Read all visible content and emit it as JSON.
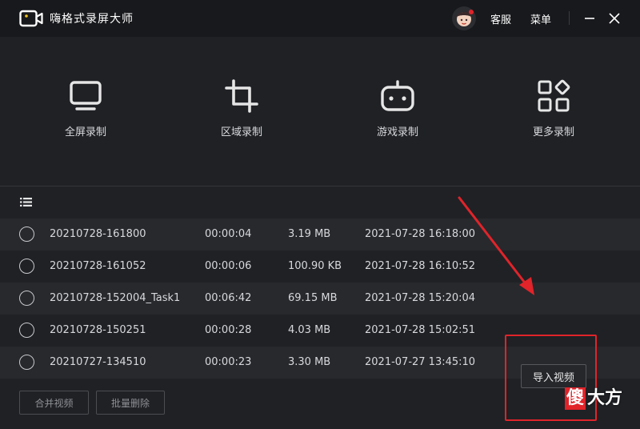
{
  "app": {
    "title": "嗨格式录屏大师",
    "icon": "video-camera-icon"
  },
  "header": {
    "service_label": "客服",
    "menu_label": "菜单",
    "minimize_icon": "minimize-icon",
    "close_icon": "close-icon",
    "avatar_icon": "user-avatar"
  },
  "record_modes": [
    {
      "label": "全屏录制",
      "icon": "monitor-icon"
    },
    {
      "label": "区域录制",
      "icon": "crop-icon"
    },
    {
      "label": "游戏录制",
      "icon": "gamepad-icon"
    },
    {
      "label": "更多录制",
      "icon": "grid-more-icon"
    }
  ],
  "list": {
    "header_icon": "list-icon",
    "rows": [
      {
        "name": "20210728-161800",
        "duration": "00:00:04",
        "size": "3.19 MB",
        "date": "2021-07-28 16:18:00"
      },
      {
        "name": "20210728-161052",
        "duration": "00:00:06",
        "size": "100.90 KB",
        "date": "2021-07-28 16:10:52"
      },
      {
        "name": "20210728-152004_Task1",
        "duration": "00:06:42",
        "size": "69.15 MB",
        "date": "2021-07-28 15:20:04"
      },
      {
        "name": "20210728-150251",
        "duration": "00:00:28",
        "size": "4.03 MB",
        "date": "2021-07-28 15:02:51"
      },
      {
        "name": "20210727-134510",
        "duration": "00:00:23",
        "size": "3.30 MB",
        "date": "2021-07-27 13:45:10"
      }
    ]
  },
  "footer": {
    "merge_label": "合并视频",
    "batch_delete_label": "批量删除",
    "import_label": "导入视频"
  },
  "watermark": {
    "first_char": "傻",
    "rest": "大方"
  },
  "colors": {
    "background": "#1f2125",
    "titlebar": "#18191c",
    "annotation": "#e0242a"
  }
}
